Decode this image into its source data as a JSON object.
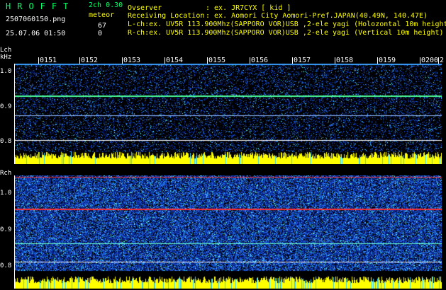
{
  "header": {
    "logo": "HROFFT",
    "version": "2ch 0.30",
    "filename": "2507060150.png",
    "datetime": "25.07.06 01:50",
    "meteor_label": "meteor",
    "count_l": "67",
    "count_r": "0",
    "observer_label": "Ovserver",
    "observer_value": ": ex. JR7CYX [ kid ]",
    "location_label": "Receiving Location",
    "location_value": ": ex. Aomori City Aomori-Pref.JAPAN(40.49N, 140.47E)",
    "lch_desc": "L-ch:ex. UV5R 113.900Mhz(SAPPORO VOR)USB ,2-ele yagi (Holozontal 10m height",
    "rch_desc": "R-ch:ex. UV5R 113.900Mhz(SAPPORO VOR)USB ,2-ele yagi (Vertical 10m height)"
  },
  "lch": {
    "label": "Lch",
    "unit": "kHz",
    "ticks": [
      "1.0",
      "0.9",
      "0.8"
    ]
  },
  "rch": {
    "label": "Rch",
    "ticks": [
      "1.0",
      "0.9",
      "0.8"
    ]
  },
  "time_labels": [
    "0151",
    "0152",
    "0153",
    "0154",
    "0155",
    "0156",
    "0157",
    "0158",
    "0159",
    "0200",
    "2"
  ],
  "colors": {
    "background": "#000000",
    "noise_dark": "#001a80",
    "noise_mid": "#0a3dbf",
    "noise_bright": "#2aa0ff",
    "signal": "#ffff00",
    "meteor_line": "#ff3030",
    "text_green": "#00ff66"
  }
}
